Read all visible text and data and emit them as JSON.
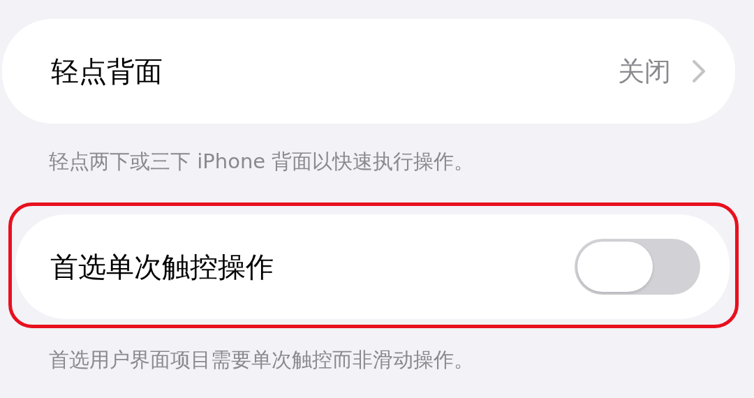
{
  "sections": [
    {
      "kind": "link",
      "label": "轻点背面",
      "value": "关闭",
      "footer": "轻点两下或三下 iPhone 背面以快速执行操作。",
      "highlighted": false
    },
    {
      "kind": "toggle",
      "label": "首选单次触控操作",
      "on": false,
      "footer": "首选用户界面项目需要单次触控而非滑动操作。",
      "highlighted": true
    }
  ]
}
